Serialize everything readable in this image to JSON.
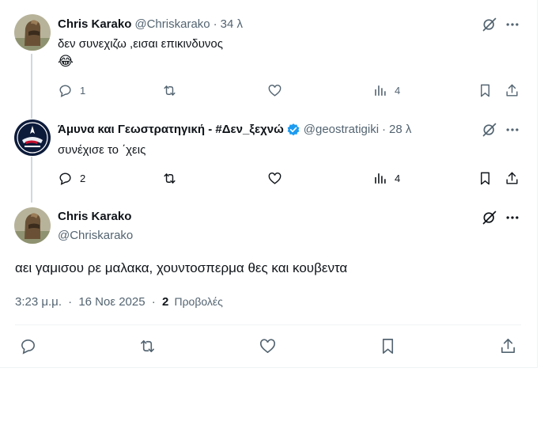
{
  "replies": [
    {
      "name": "Chris Karako",
      "handle": "@Chriskarako",
      "time": "34 λ",
      "text": "δεν συνεχιζω ,εισαι επικινδυνος",
      "emoji": "😂",
      "replies_count": "1",
      "views_count": "4"
    },
    {
      "name": "Άμυνα και Γεωστρατηγική - #Δεν_ξεχνώ",
      "handle": "@geostratigiki",
      "time": "28 λ",
      "text": "συνέχισε το ΄χεις",
      "replies_count": "2",
      "views_count": "4"
    }
  ],
  "main_tweet": {
    "name": "Chris Karako",
    "handle": "@Chriskarako",
    "text": "αει γαμισου ρε μαλακα, χουντοσπερμα θες και κουβεντα",
    "time": "3:23 μ.μ.",
    "date": "16 Νοε 2025",
    "views_count": "2",
    "views_label": "Προβολές"
  },
  "separator": "·",
  "colors": {
    "text": "#0f1419",
    "secondary": "#536471",
    "verified": "#1d9bf0",
    "border": "#eff3f4"
  },
  "icons": [
    "grok-icon",
    "more-icon",
    "reply-icon",
    "retweet-icon",
    "like-icon",
    "views-icon",
    "bookmark-icon",
    "share-icon",
    "verified-badge-icon"
  ]
}
